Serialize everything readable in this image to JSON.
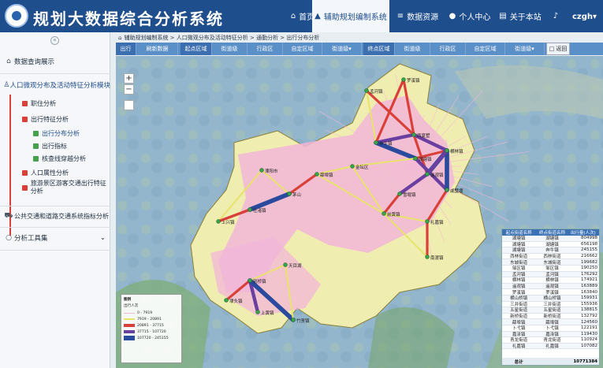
{
  "app": {
    "title": "规划大数据综合分析系统"
  },
  "nav": [
    {
      "label": "首页",
      "icon": "home-icon"
    },
    {
      "label": "辅助规划编制系统",
      "icon": "chart-icon"
    },
    {
      "label": "数据资源",
      "icon": "database-icon"
    },
    {
      "label": "个人中心",
      "icon": "user-icon"
    },
    {
      "label": "关于本站",
      "icon": "info-icon"
    }
  ],
  "user": {
    "name": "czgh"
  },
  "sidebar": {
    "items": [
      {
        "label": "数据查询展示"
      },
      {
        "label": "人口微观分布及活动特征分析模块"
      },
      {
        "label": "职住分析"
      },
      {
        "label": "出行特征分析"
      },
      {
        "label": "出行分布分析"
      },
      {
        "label": "出行指标"
      },
      {
        "label": "核查线穿越分析"
      },
      {
        "label": "人口属性分析"
      },
      {
        "label": "旅游景区游客交通出行特征分析"
      },
      {
        "label": "公共交通和道路交通系统指标分析"
      },
      {
        "label": "分析工具集"
      }
    ]
  },
  "breadcrumb": "辅助规划编制系统 > 人口微观分布及活动特征分析 > 通勤分析 > 出行分布分析",
  "toolbar": {
    "buttons": [
      {
        "label": "出行"
      },
      {
        "label": "刷新数据"
      },
      {
        "label": "起点区域"
      },
      {
        "label": "街道级"
      },
      {
        "label": "行政区"
      },
      {
        "label": "自定区域"
      },
      {
        "label": "街道级"
      },
      {
        "label": "终点区域"
      },
      {
        "label": "街道级"
      },
      {
        "label": "行政区"
      },
      {
        "label": "自定区域"
      },
      {
        "label": "街道级"
      },
      {
        "label": "□ 返回"
      }
    ]
  },
  "map": {
    "zoom_in": "+",
    "zoom_out": "−",
    "towns": [
      "孟河镇",
      "罗溪镇",
      "奔牛镇",
      "西夏墅",
      "湖塘镇",
      "遥观镇",
      "横林镇",
      "戚墅堰",
      "雪堰镇",
      "前黄镇",
      "礼嘉镇",
      "金坛区",
      "薛埠镇",
      "茅山",
      "溧阳市",
      "社渚镇",
      "上兴镇",
      "天目湖",
      "别桥镇",
      "埭头镇",
      "上黄镇",
      "竹箦镇",
      "南渡镇"
    ]
  },
  "od_table": {
    "headers": [
      "起点街道名称",
      "终点街道名称",
      "出行量(人次)"
    ],
    "rows": [
      [
        "湖塘镇",
        "湖塘镇",
        "804998"
      ],
      [
        "湖塘镇",
        "湖塘镇",
        "656198"
      ],
      [
        "湖塘镇",
        "奔牛镇",
        "245155"
      ],
      [
        "西林街道",
        "西林街道",
        "216662"
      ],
      [
        "东城街道",
        "东城街道",
        "199682"
      ],
      [
        "邹区镇",
        "邹区镇",
        "190250"
      ],
      [
        "孟河镇",
        "孟河镇",
        "176292"
      ],
      [
        "横林镇",
        "横林镇",
        "174921"
      ],
      [
        "遥观镇",
        "遥观镇",
        "163889"
      ],
      [
        "罗溪镇",
        "罗溪镇",
        "163840"
      ],
      [
        "横山桥镇",
        "横山桥镇",
        "159931"
      ],
      [
        "三井街道",
        "三井街道",
        "155936"
      ],
      [
        "五星街道",
        "五星街道",
        "138815"
      ],
      [
        "新桥街道",
        "新桥街道",
        "132792"
      ],
      [
        "薛埠镇",
        "薛埠镇",
        "124560"
      ],
      [
        "卜弋镇",
        "卜弋镇",
        "122191"
      ],
      [
        "嘉泽镇",
        "嘉泽镇",
        "119430"
      ],
      [
        "青龙街道",
        "青龙街道",
        "110924"
      ],
      [
        "礼嘉镇",
        "礼嘉镇",
        "107082"
      ]
    ],
    "total_label": "总计",
    "total_value": "10771384"
  },
  "legend": {
    "title": "图例",
    "subtitle": "出行人次",
    "items": [
      {
        "label": "0 - 7919",
        "color": "#f5b8d8"
      },
      {
        "label": "7919 - 20891",
        "color": "#e8e36a"
      },
      {
        "label": "20891 - 37715",
        "color": "#d9403a"
      },
      {
        "label": "37715 - 107720",
        "color": "#6b3fa0"
      },
      {
        "label": "107720 - 245155",
        "color": "#2a4a9e"
      }
    ]
  }
}
